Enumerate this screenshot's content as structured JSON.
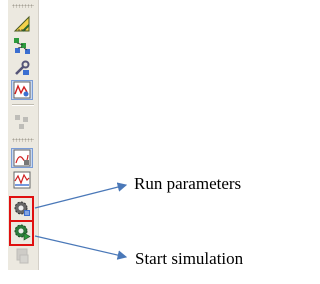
{
  "toolbar": {
    "buttons": [
      {
        "icon": "triangle-ruler-icon",
        "state": "normal"
      },
      {
        "icon": "network-nodes-icon",
        "state": "normal"
      },
      {
        "icon": "wrench-settings-icon",
        "state": "normal"
      },
      {
        "icon": "waveform-plot-icon",
        "state": "pressed"
      },
      {
        "icon": "grid-blocks-icon",
        "state": "disabled"
      },
      {
        "icon": "scope-window-icon",
        "state": "pressed"
      },
      {
        "icon": "signal-graph-icon",
        "state": "normal"
      },
      {
        "icon": "run-parameters-gear-icon",
        "state": "normal"
      },
      {
        "icon": "start-simulation-gear-play-icon",
        "state": "normal"
      },
      {
        "icon": "stop-simulation-icon",
        "state": "disabled"
      }
    ]
  },
  "annotations": {
    "run_parameters": "Run parameters",
    "start_simulation": "Start simulation"
  },
  "colors": {
    "highlight_box": "#e01010",
    "arrow": "#4a78b8"
  }
}
